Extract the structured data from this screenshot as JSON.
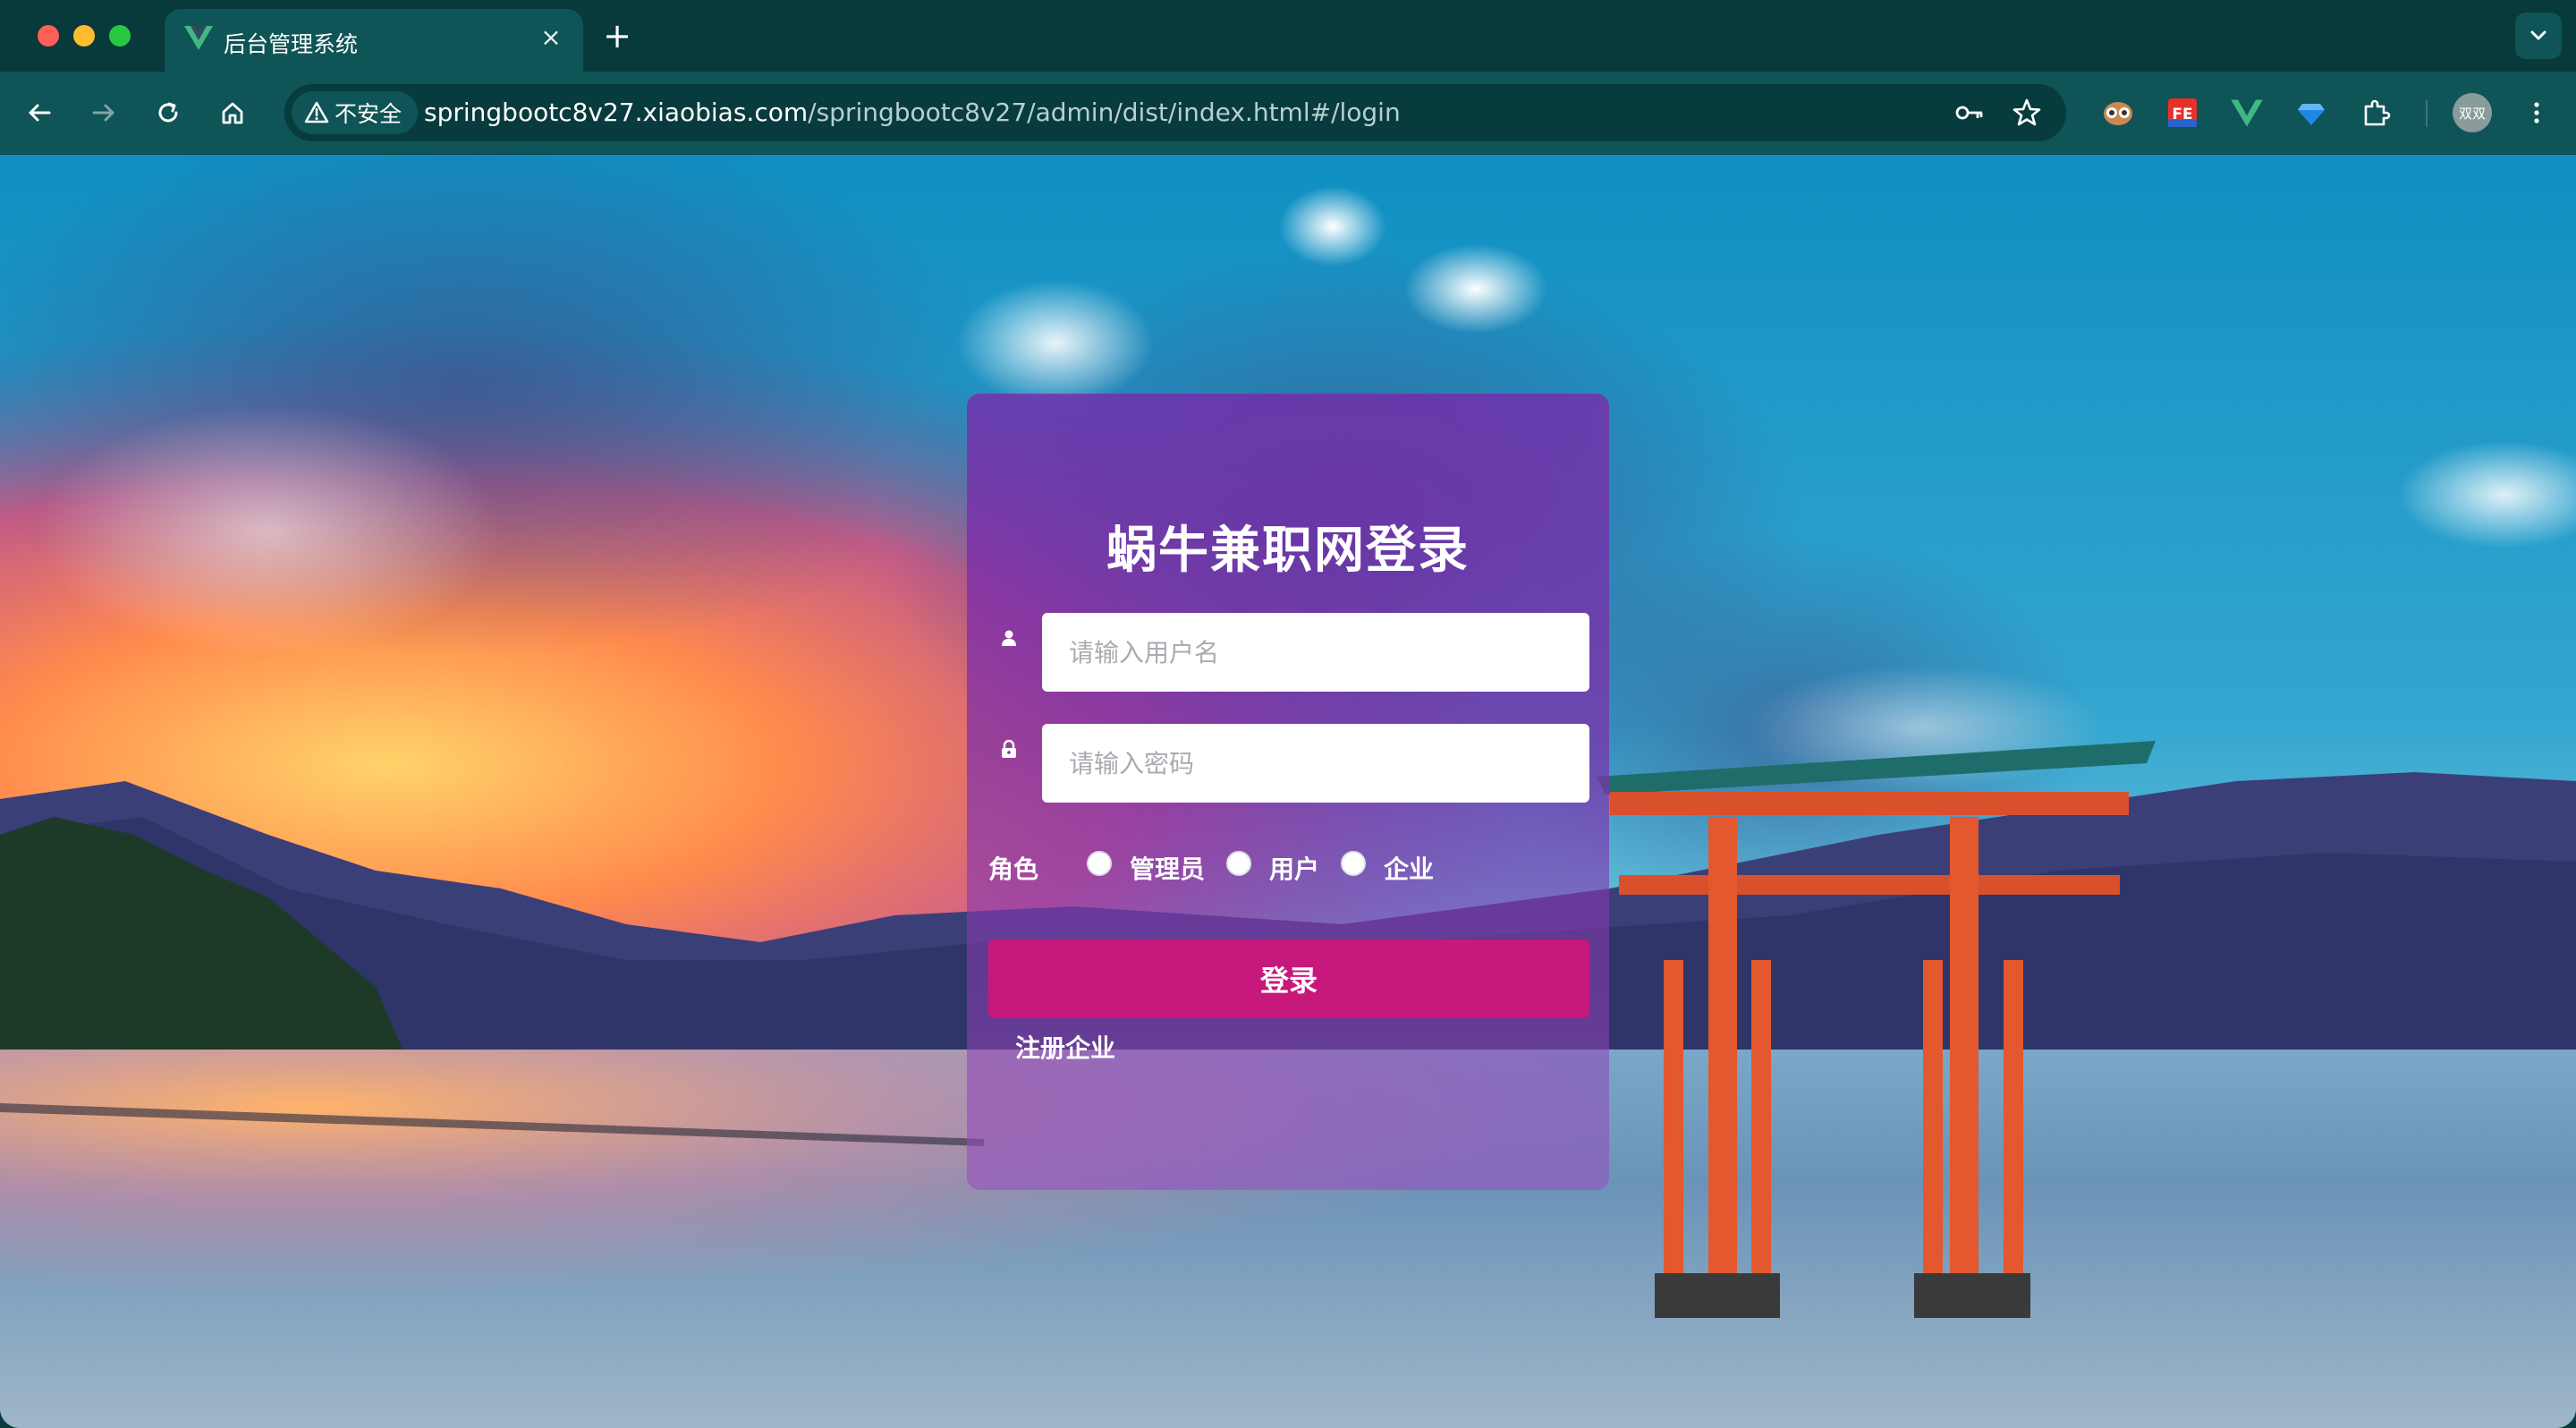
{
  "browser": {
    "tab_title": "后台管理系统",
    "tab_close": "×",
    "new_tab": "+",
    "security_label": "不安全",
    "url_host": "springbootc8v27.xiaobias.com",
    "url_path": "/springbootc8v27/admin/dist/index.html#/login",
    "profile_label": "双双",
    "extension_fe_label": "FE"
  },
  "login": {
    "title": "蜗牛兼职网登录",
    "username_placeholder": "请输入用户名",
    "password_placeholder": "请输入密码",
    "role_label": "角色",
    "roles": [
      "管理员",
      "用户",
      "企业"
    ],
    "submit_label": "登录",
    "register_link": "注册企业"
  },
  "colors": {
    "chrome_bg": "#08393b",
    "toolbar_bg": "#0f5456",
    "login_button": "#c7187c",
    "card_tint": "#7e2eaa"
  },
  "icons": [
    "back-icon",
    "forward-icon",
    "reload-icon",
    "home-icon",
    "warning-icon",
    "key-icon",
    "star-icon",
    "user-icon",
    "lock-icon",
    "vue-logo-icon",
    "puzzle-icon",
    "menu-dots-icon"
  ]
}
